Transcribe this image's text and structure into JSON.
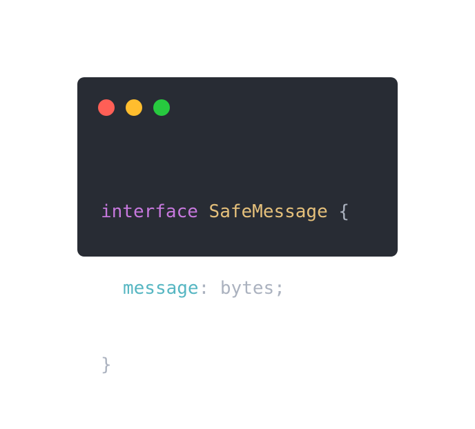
{
  "window": {
    "background": "#282c34",
    "controls": [
      {
        "name": "close",
        "color": "#ff5f56"
      },
      {
        "name": "minimize",
        "color": "#ffbd2e"
      },
      {
        "name": "zoom",
        "color": "#27c93f"
      }
    ]
  },
  "code": {
    "lines": [
      {
        "tokens": [
          {
            "text": "interface",
            "color": "#c678dd"
          },
          {
            "text": " ",
            "color": "#abb2bf"
          },
          {
            "text": "SafeMessage",
            "color": "#e5c07b"
          },
          {
            "text": " {",
            "color": "#abb2bf"
          }
        ]
      },
      {
        "tokens": [
          {
            "text": "message",
            "color": "#56b6c2"
          },
          {
            "text": ": bytes;",
            "color": "#abb2bf"
          }
        ]
      },
      {
        "tokens": [
          {
            "text": "}",
            "color": "#abb2bf"
          }
        ]
      }
    ]
  }
}
